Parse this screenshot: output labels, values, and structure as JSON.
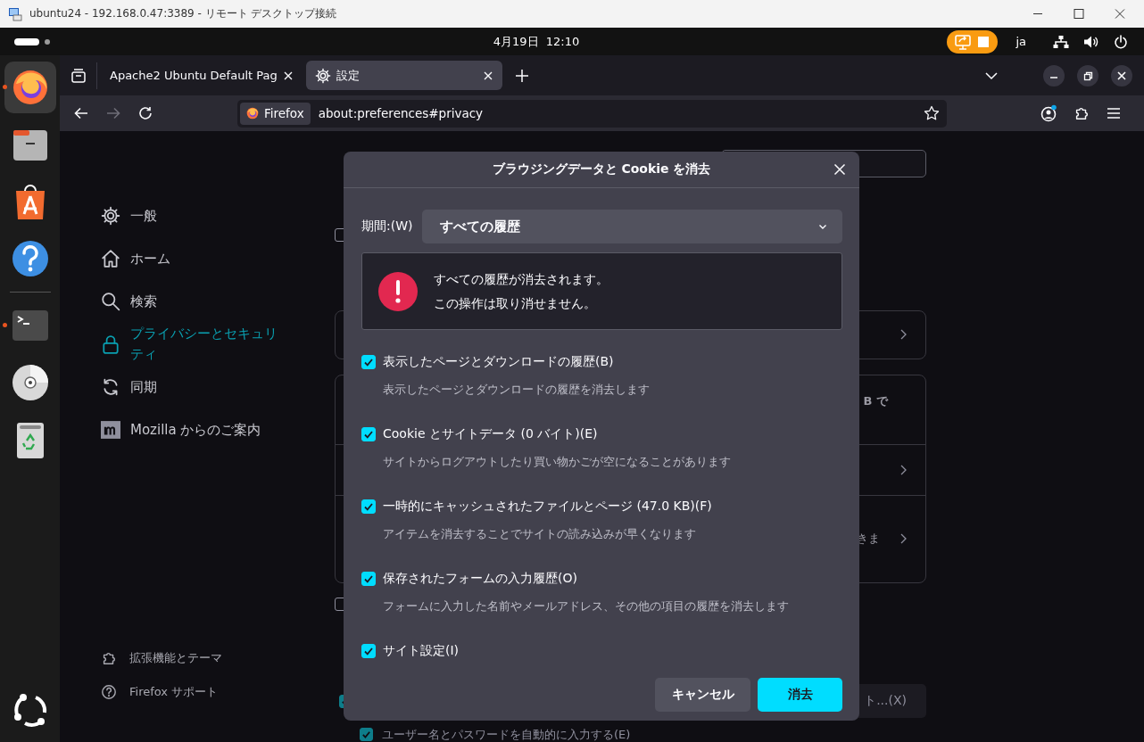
{
  "rdp_window": {
    "title": "ubuntu24 - 192.168.0.47:3389 - リモート デスクトップ接続"
  },
  "top_bar": {
    "clock": "4月19日  12:10",
    "input_method": "ja"
  },
  "dock": {
    "apps": [
      {
        "kind": "firefox",
        "selected": true,
        "running": true
      },
      {
        "kind": "files",
        "selected": false,
        "running": false
      },
      {
        "kind": "appcenter",
        "selected": false,
        "running": false
      },
      {
        "kind": "help",
        "selected": false,
        "running": false
      },
      {
        "kind": "separator"
      },
      {
        "kind": "terminal",
        "selected": false,
        "running": true
      },
      {
        "kind": "disc",
        "selected": false,
        "running": false
      },
      {
        "kind": "trash",
        "selected": false,
        "running": false
      }
    ]
  },
  "tabs": [
    {
      "title": "Apache2 Ubuntu Default Pag",
      "kind": "web",
      "selected": false
    },
    {
      "title": "設定",
      "kind": "settings",
      "selected": true
    }
  ],
  "address_bar": {
    "identity": "Firefox",
    "url": "about:preferences#privacy"
  },
  "sidebar": {
    "categories": [
      {
        "kind": "gear",
        "label": "一般",
        "selected": false
      },
      {
        "kind": "home",
        "label": "ホーム",
        "selected": false
      },
      {
        "kind": "search",
        "label": "検索",
        "selected": false
      },
      {
        "kind": "lock",
        "label": "プライバシーとセキュリティ",
        "selected": true
      },
      {
        "kind": "sync",
        "label": "同期",
        "selected": false
      },
      {
        "kind": "mozilla",
        "label": "Mozilla からのご案内",
        "selected": false
      }
    ],
    "footer": [
      {
        "kind": "puzzle",
        "label": "拡張機能とテーマ"
      },
      {
        "kind": "help",
        "label": "Firefox サポート"
      }
    ]
  },
  "background": {
    "checkbox_top": {
      "checked": false
    },
    "card_row_texts": [
      "B で",
      "きま"
    ],
    "checkbox_middle": {
      "checked": false
    },
    "checkbox_lower": {
      "checked": true
    },
    "button": "ト...(X)",
    "autofill": {
      "label": "ユーザー名とパスワードを自動的に入力する(E)",
      "checked": true
    }
  },
  "dialog": {
    "title": "ブラウジングデータと Cookie を消去",
    "period_label": "期間:(W)",
    "period_value": "すべての履歴",
    "warning": [
      "すべての履歴が消去されます。",
      "この操作は取り消せません。"
    ],
    "options": [
      {
        "label": "表示したページとダウンロードの履歴(B)",
        "description": "表示したページとダウンロードの履歴を消去します",
        "checked": true
      },
      {
        "label": "Cookie とサイトデータ (0 バイト)(E)",
        "description": "サイトからログアウトしたり買い物かごが空になることがあります",
        "checked": true
      },
      {
        "label": "一時的にキャッシュされたファイルとページ (47.0 KB)(F)",
        "description": "アイテムを消去することでサイトの読み込みが早くなります",
        "checked": true
      },
      {
        "label": "保存されたフォームの入力履歴(O)",
        "description": "フォームに入力した名前やメールアドレス、その他の項目の履歴を消去します",
        "checked": true
      },
      {
        "label": "サイト設定(I)",
        "checked": true
      }
    ],
    "buttons": [
      {
        "label": "キャンセル",
        "kind": "secondary"
      },
      {
        "label": "消去",
        "kind": "primary"
      }
    ]
  }
}
